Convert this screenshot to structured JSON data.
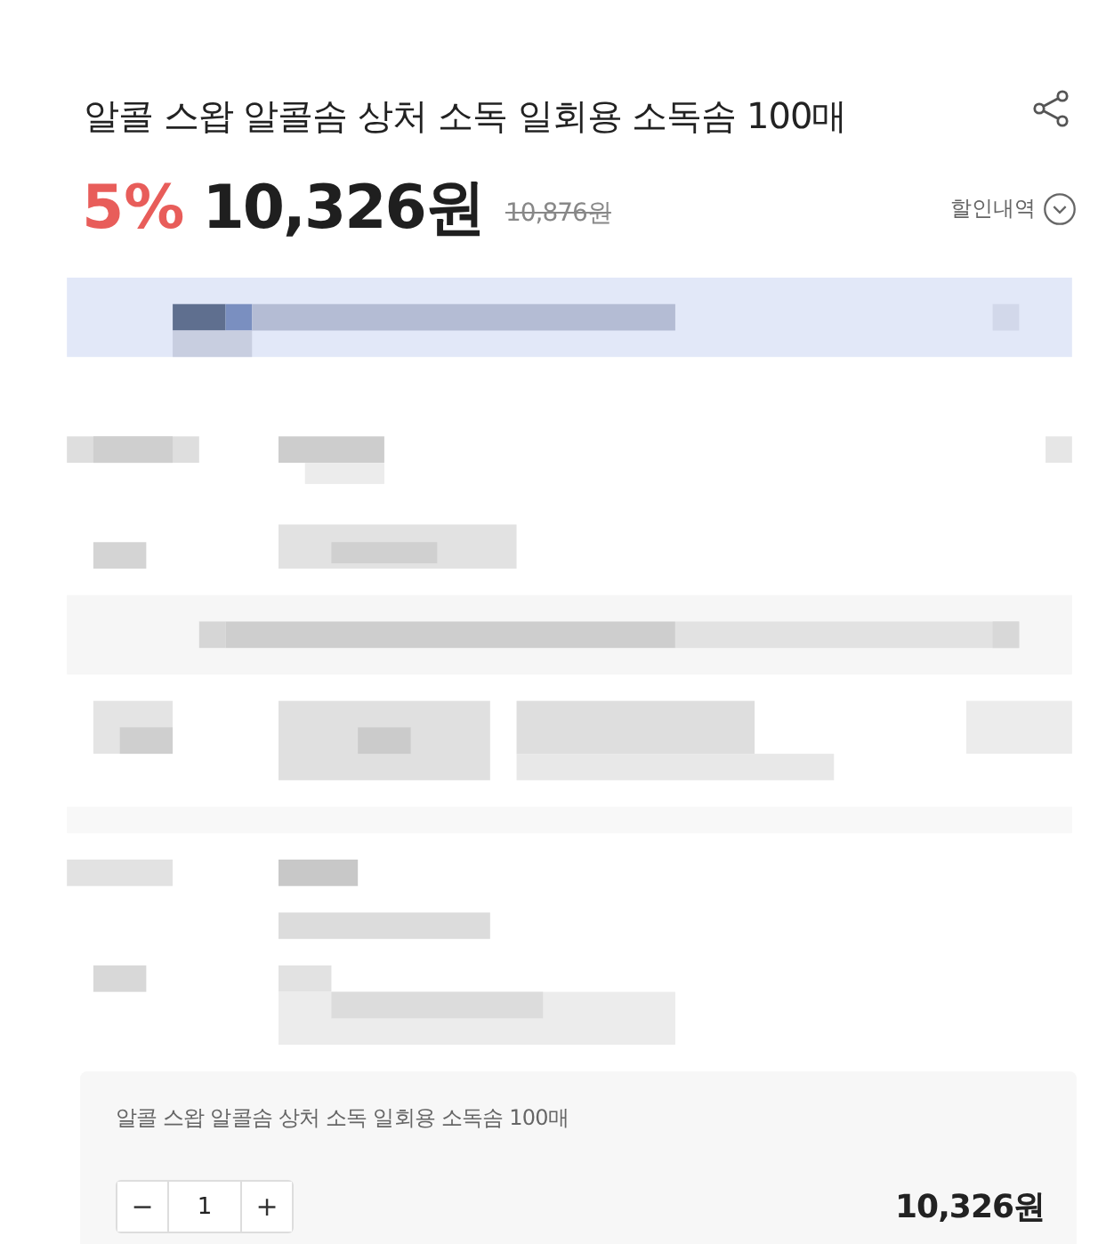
{
  "product": {
    "title": "알콜 스왑 알콜솜 상처 소독 일회용 소독솜 100매"
  },
  "price": {
    "discount_rate": "5%",
    "sale_price": "10,326원",
    "original_price": "10,876원",
    "discount_history_label": "할인내역"
  },
  "selected_option": {
    "name": "알콜 스왑 알콜솜 상처 소독 일회용 소독솜 100매",
    "quantity": "1",
    "decrease": "−",
    "increase": "+",
    "total": "10,326원"
  }
}
